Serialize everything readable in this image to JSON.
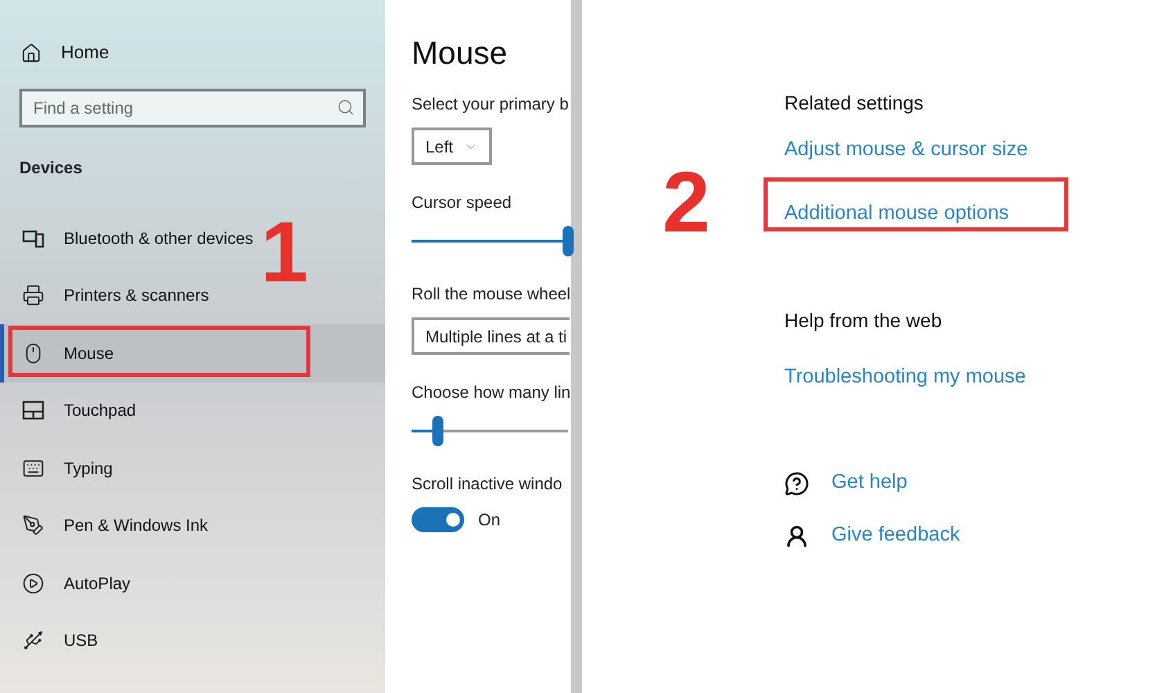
{
  "sidebar": {
    "home": "Home",
    "search": {
      "placeholder": "Find a setting"
    },
    "section": "Devices",
    "items": [
      {
        "label": "Bluetooth & other devices",
        "kind": "bluetooth",
        "selected": false
      },
      {
        "label": "Printers & scanners",
        "kind": "printer",
        "selected": false
      },
      {
        "label": "Mouse",
        "kind": "mouse",
        "selected": true
      },
      {
        "label": "Touchpad",
        "kind": "touchpad",
        "selected": false
      },
      {
        "label": "Typing",
        "kind": "keyboard",
        "selected": false
      },
      {
        "label": "Pen & Windows Ink",
        "kind": "pen",
        "selected": false
      },
      {
        "label": "AutoPlay",
        "kind": "autoplay",
        "selected": false
      },
      {
        "label": "USB",
        "kind": "usb",
        "selected": false
      }
    ]
  },
  "main": {
    "title": "Mouse",
    "controls": [
      {
        "kind": "dropdown",
        "label": "Select your primary b",
        "value": "Left",
        "wide": false
      },
      {
        "kind": "slider",
        "label": "Cursor speed",
        "level": 1
      },
      {
        "kind": "dropdown",
        "label": "Roll the mouse wheel",
        "value": "Multiple lines at a ti",
        "wide": true
      },
      {
        "kind": "slider",
        "label": "Choose how many lin",
        "level": 0.17
      },
      {
        "kind": "toggle",
        "label": "Scroll inactive windo",
        "on": true,
        "state": "On"
      }
    ]
  },
  "related": {
    "title": "Related settings",
    "links": [
      "Adjust mouse & cursor size",
      "Additional mouse options"
    ]
  },
  "help": {
    "title": "Help from the web",
    "links": [
      "Troubleshooting my mouse"
    ]
  },
  "support": [
    {
      "label": "Get help",
      "kind": "help"
    },
    {
      "label": "Give feedback",
      "kind": "feedback"
    }
  ],
  "annotations": [
    {
      "number": "1"
    },
    {
      "number": "2"
    }
  ]
}
